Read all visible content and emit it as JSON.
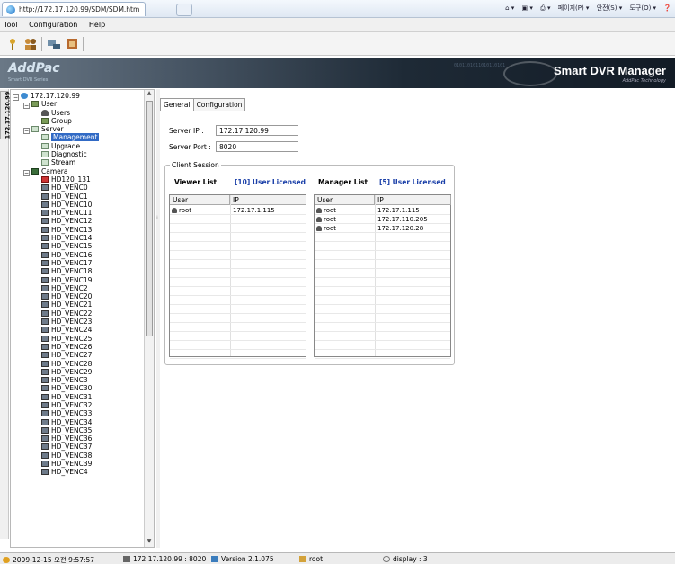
{
  "browser": {
    "tab_title": "http://172.17.120.99/SDM/SDM.htm",
    "commands": [
      "페이지(P) ▾",
      "안전(S) ▾",
      "도구(O) ▾"
    ]
  },
  "menubar": {
    "items": [
      "Tool",
      "Configuration",
      "Help"
    ]
  },
  "banner": {
    "logo": "AddPac",
    "logo_sub": "Smart DVR Series",
    "title": "Smart DVR Manager",
    "subtitle": "AddPac Technology",
    "binary": "0101101011010110101"
  },
  "left_tab": "172.17.120.99",
  "tree": {
    "root": "172.17.120.99",
    "user": "User",
    "users": "Users",
    "group": "Group",
    "server": "Server",
    "management": "Management",
    "upgrade": "Upgrade",
    "diagnostic": "Diagnostic",
    "stream": "Stream",
    "camera": "Camera",
    "cameras": [
      "HD120_131",
      "HD_VENC0",
      "HD_VENC1",
      "HD_VENC10",
      "HD_VENC11",
      "HD_VENC12",
      "HD_VENC13",
      "HD_VENC14",
      "HD_VENC15",
      "HD_VENC16",
      "HD_VENC17",
      "HD_VENC18",
      "HD_VENC19",
      "HD_VENC2",
      "HD_VENC20",
      "HD_VENC21",
      "HD_VENC22",
      "HD_VENC23",
      "HD_VENC24",
      "HD_VENC25",
      "HD_VENC26",
      "HD_VENC27",
      "HD_VENC28",
      "HD_VENC29",
      "HD_VENC3",
      "HD_VENC30",
      "HD_VENC31",
      "HD_VENC32",
      "HD_VENC33",
      "HD_VENC34",
      "HD_VENC35",
      "HD_VENC36",
      "HD_VENC37",
      "HD_VENC38",
      "HD_VENC39",
      "HD_VENC4"
    ]
  },
  "main": {
    "tabs": [
      "General",
      "Configuration"
    ],
    "server_ip_label": "Server IP :",
    "server_ip": "172.17.120.99",
    "server_port_label": "Server Port :",
    "server_port": "8020",
    "client_session_label": "Client Session",
    "viewer": {
      "title": "Viewer List",
      "licensed": "[10] User Licensed",
      "col_user": "User",
      "col_ip": "IP",
      "rows": [
        {
          "user": "root",
          "ip": "172.17.1.115"
        }
      ]
    },
    "manager": {
      "title": "Manager List",
      "licensed": "[5] User Licensed",
      "col_user": "User",
      "col_ip": "IP",
      "rows": [
        {
          "user": "root",
          "ip": "172.17.1.115"
        },
        {
          "user": "root",
          "ip": "172.17.110.205"
        },
        {
          "user": "root",
          "ip": "172.17.120.28"
        }
      ]
    }
  },
  "status": {
    "datetime": "2009-12-15 오전 9:57:57",
    "server": "172.17.120.99 : 8020",
    "version": "Version 2.1.075",
    "user": "root",
    "display": "display : 3"
  }
}
